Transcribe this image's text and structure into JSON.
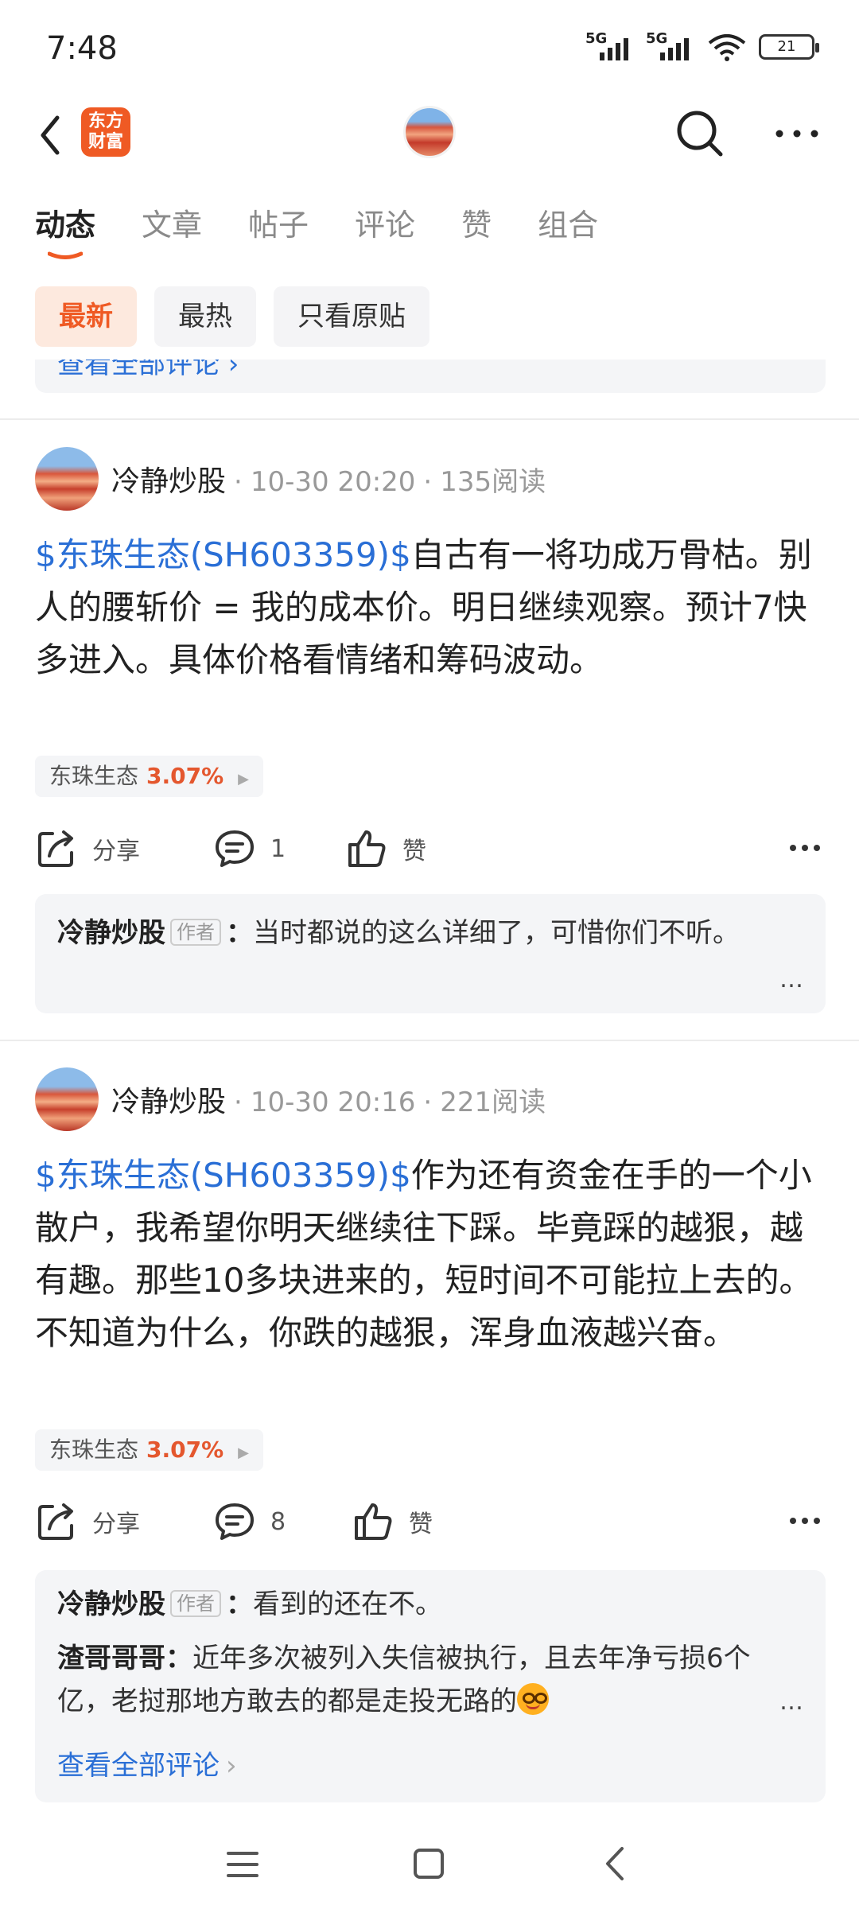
{
  "status_bar": {
    "time": "7:48",
    "net1": "5G",
    "net2": "5G",
    "battery": "21"
  },
  "header": {
    "logo_text_line1": "东方",
    "logo_text_line2": "财富"
  },
  "tabs": [
    {
      "label": "动态"
    },
    {
      "label": "文章"
    },
    {
      "label": "帖子"
    },
    {
      "label": "评论"
    },
    {
      "label": "赞"
    },
    {
      "label": "组合"
    }
  ],
  "filters": [
    {
      "label": "最新"
    },
    {
      "label": "最热"
    },
    {
      "label": "只看原贴"
    }
  ],
  "partial_card": {
    "link_text": "查看全部评论 ›"
  },
  "posts": [
    {
      "author": "冷静炒股",
      "time": "10-30 20:20",
      "reads": "135阅读",
      "ticker": "$东珠生态(SH603359)$",
      "text": "自古有一将功成万骨枯。别人的腰斩价 = 我的成本价。明日继续观察。预计7快多进入。具体价格看情绪和筹码波动。",
      "stock_name": "东珠生态",
      "stock_change": "3.07%",
      "share_label": "分享",
      "comment_count": "1",
      "like_label": "赞",
      "comments": [
        {
          "author": "冷静炒股",
          "badge": "作者",
          "text": "当时都说的这么详细了，可惜你们不听。"
        }
      ]
    },
    {
      "author": "冷静炒股",
      "time": "10-30 20:16",
      "reads": "221阅读",
      "ticker": "$东珠生态(SH603359)$",
      "text": "作为还有资金在手的一个小散户，我希望你明天继续往下踩。毕竟踩的越狠，越有趣。那些10多块进来的，短时间不可能拉上去的。不知道为什么，你跌的越狠，浑身血液越兴奋。",
      "stock_name": "东珠生态",
      "stock_change": "3.07%",
      "share_label": "分享",
      "comment_count": "8",
      "like_label": "赞",
      "comments": [
        {
          "author": "冷静炒股",
          "badge": "作者",
          "text": "看到的还在不。"
        },
        {
          "author": "渣哥哥哥",
          "text": "近年多次被列入失信被执行，且去年净亏损6个亿，老挝那地方敢去的都是走投无路的",
          "emoji": "grinning-face-emoji"
        }
      ],
      "view_all": "查看全部评论"
    }
  ],
  "colors": {
    "accent": "#ef5a24",
    "link": "#2a6fd6",
    "rise": "#e4572e"
  }
}
